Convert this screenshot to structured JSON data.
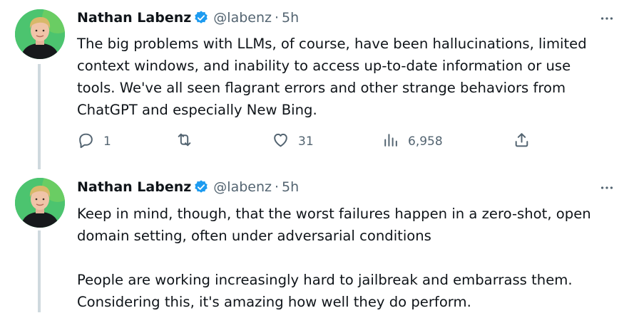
{
  "tweets": [
    {
      "author_name": "Nathan Labenz",
      "handle": "@labenz",
      "separator": "·",
      "time": "5h",
      "paragraphs": [
        "The big problems with LLMs, of course, have been hallucinations, limited context windows, and inability to access up-to-date information or use tools.  We've all seen flagrant errors and other strange behaviors from ChatGPT and especially New Bing."
      ],
      "stats": {
        "replies": "1",
        "retweets": "",
        "likes": "31",
        "views": "6,958"
      }
    },
    {
      "author_name": "Nathan Labenz",
      "handle": "@labenz",
      "separator": "·",
      "time": "5h",
      "paragraphs": [
        "Keep in mind, though, that the worst failures happen in a zero-shot, open domain setting, often under adversarial conditions",
        "People are working increasingly hard to jailbreak and embarrass them. Considering this, it's amazing how well they do perform."
      ]
    }
  ],
  "icons": {
    "more": "more-dots-icon",
    "reply": "reply-icon",
    "retweet": "retweet-icon",
    "like": "heart-icon",
    "views": "views-icon",
    "share": "share-icon",
    "verified": "verified-badge-icon"
  },
  "colors": {
    "text": "#0f1419",
    "secondary": "#536471",
    "verified": "#1d9bf0",
    "thread_line": "#cfd9de"
  }
}
